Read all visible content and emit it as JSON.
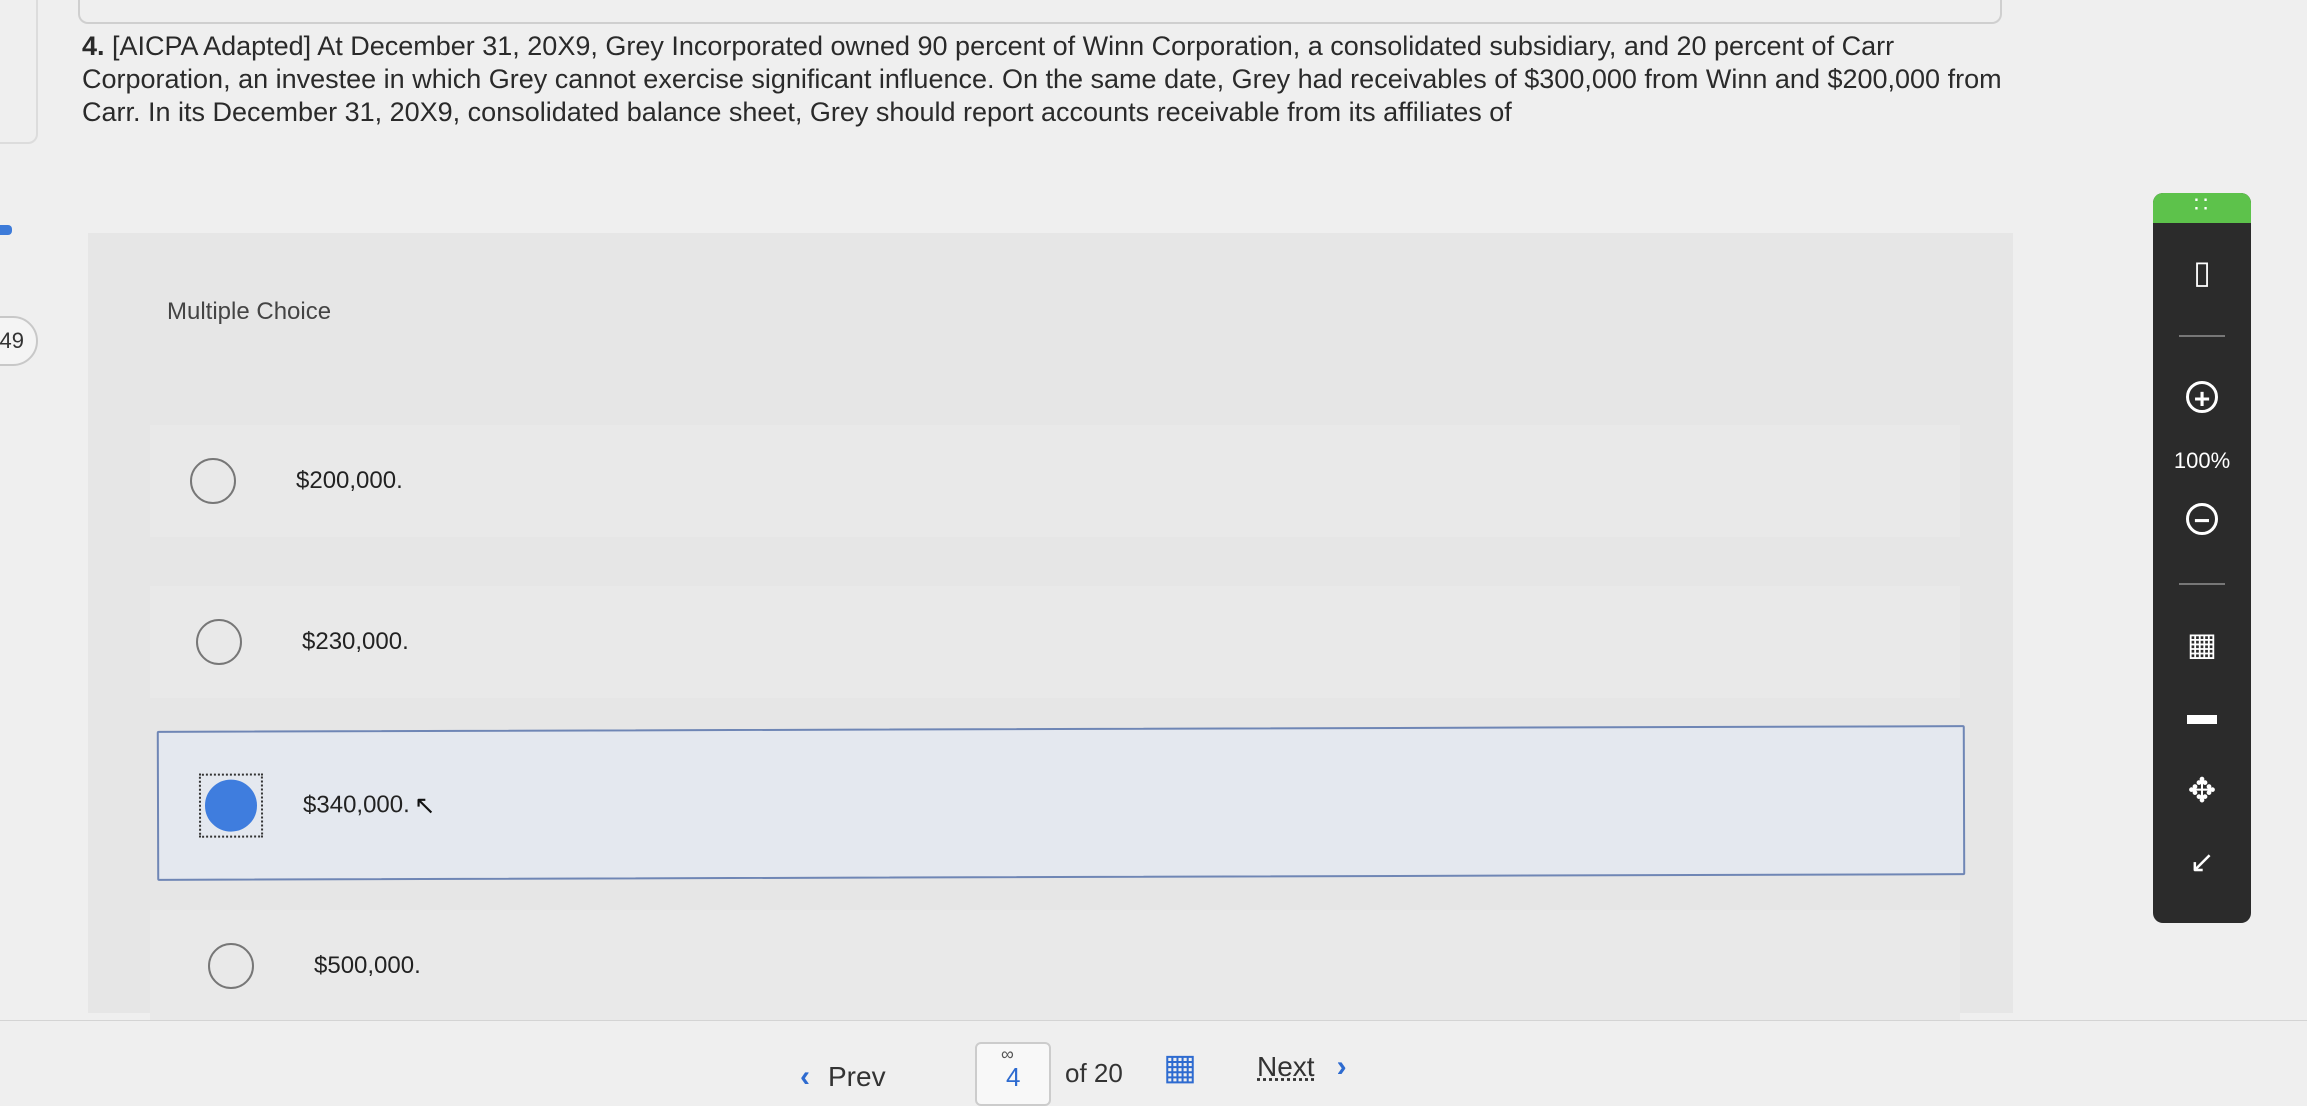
{
  "question": {
    "number": "4.",
    "text": "[AICPA Adapted] At December 31, 20X9, Grey Incorporated owned 90 percent of Winn Corporation, a consolidated subsidiary, and 20 percent of Carr Corporation, an investee in which Grey cannot exercise significant influence. On the same date, Grey had receivables of $300,000 from Winn and $200,000 from Carr. In its December 31, 20X9, consolidated balance sheet, Grey should report accounts receivable from its affiliates of"
  },
  "side_badge": "49",
  "multiple_choice_label": "Multiple Choice",
  "options": [
    {
      "label": "$200,000.",
      "selected": false
    },
    {
      "label": "$230,000.",
      "selected": false
    },
    {
      "label": "$340,000.",
      "selected": true
    },
    {
      "label": "$500,000.",
      "selected": false
    }
  ],
  "footer": {
    "prev_label": "Prev",
    "current_page": "4",
    "of_label": "of 20",
    "next_label": "Next"
  },
  "toolbar": {
    "zoom": "100%",
    "icons": [
      "drag-handle-icon",
      "battery-icon",
      "zoom-in-icon",
      "zoom-out-icon",
      "calculator-icon",
      "comment-icon",
      "move-icon",
      "collapse-icon"
    ]
  },
  "colors": {
    "accent": "#3f7dde",
    "toolbar_bg": "#2b2b2b",
    "toolbar_handle": "#5dc24b"
  }
}
